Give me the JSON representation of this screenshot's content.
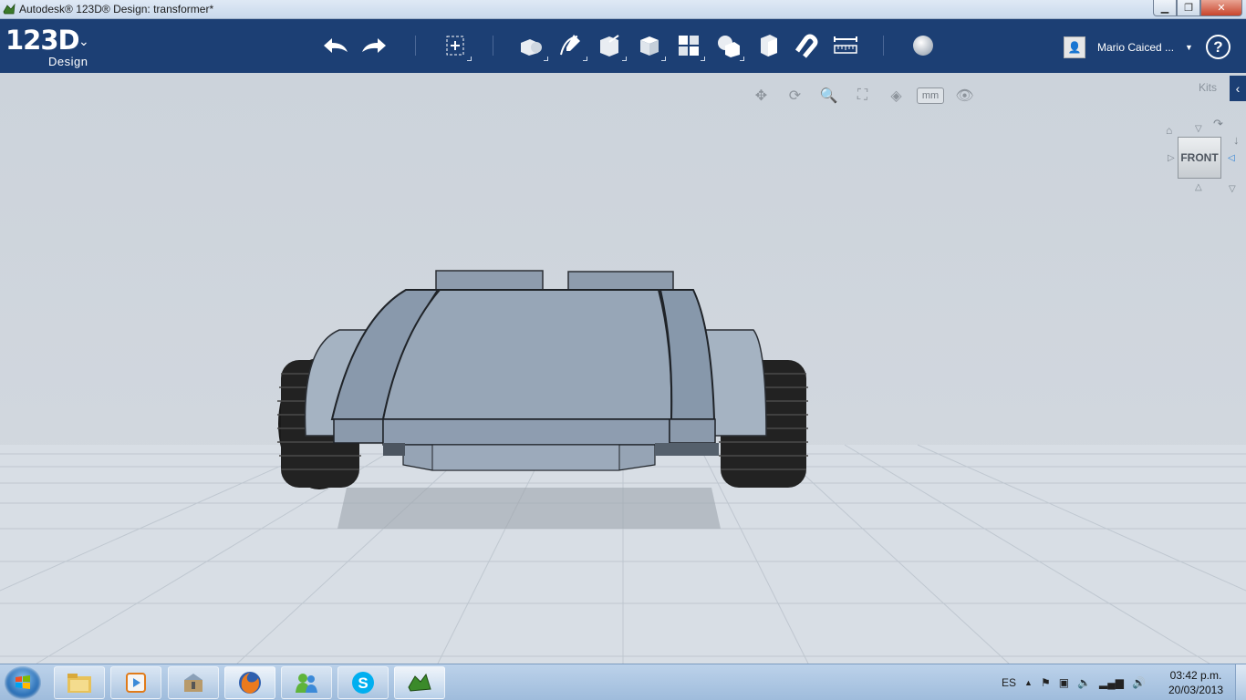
{
  "window": {
    "title": "Autodesk® 123D® Design: transformer*",
    "controls": [
      "minimize",
      "maximize",
      "close"
    ]
  },
  "toolbar": {
    "logo_main": "123D",
    "logo_sub": "Design",
    "tools": [
      "undo-icon",
      "redo-icon",
      "transform-icon",
      "primitives-icon",
      "sketch-icon",
      "construct-icon",
      "modify-icon",
      "pattern-icon",
      "grouping-icon",
      "combine-icon",
      "snap-icon",
      "measure-icon",
      "material-icon"
    ],
    "username": "Mario Caiced ...",
    "help": "?"
  },
  "viewport": {
    "kits_label": "Kits",
    "nav_tools": [
      "pan-icon",
      "orbit-icon",
      "zoom-icon",
      "fit-icon",
      "view-mode-icon"
    ],
    "units": "mm",
    "viewcube_face": "FRONT"
  },
  "taskbar": {
    "apps": [
      "explorer",
      "media-player",
      "archive",
      "firefox",
      "messenger",
      "skype",
      "123d-design"
    ],
    "language": "ES",
    "time": "03:42 p.m.",
    "date": "20/03/2013"
  },
  "colors": {
    "toolbar_bg": "#1c3f74",
    "model_body": "#95a4b5",
    "wheel": "#1a1a1a"
  }
}
